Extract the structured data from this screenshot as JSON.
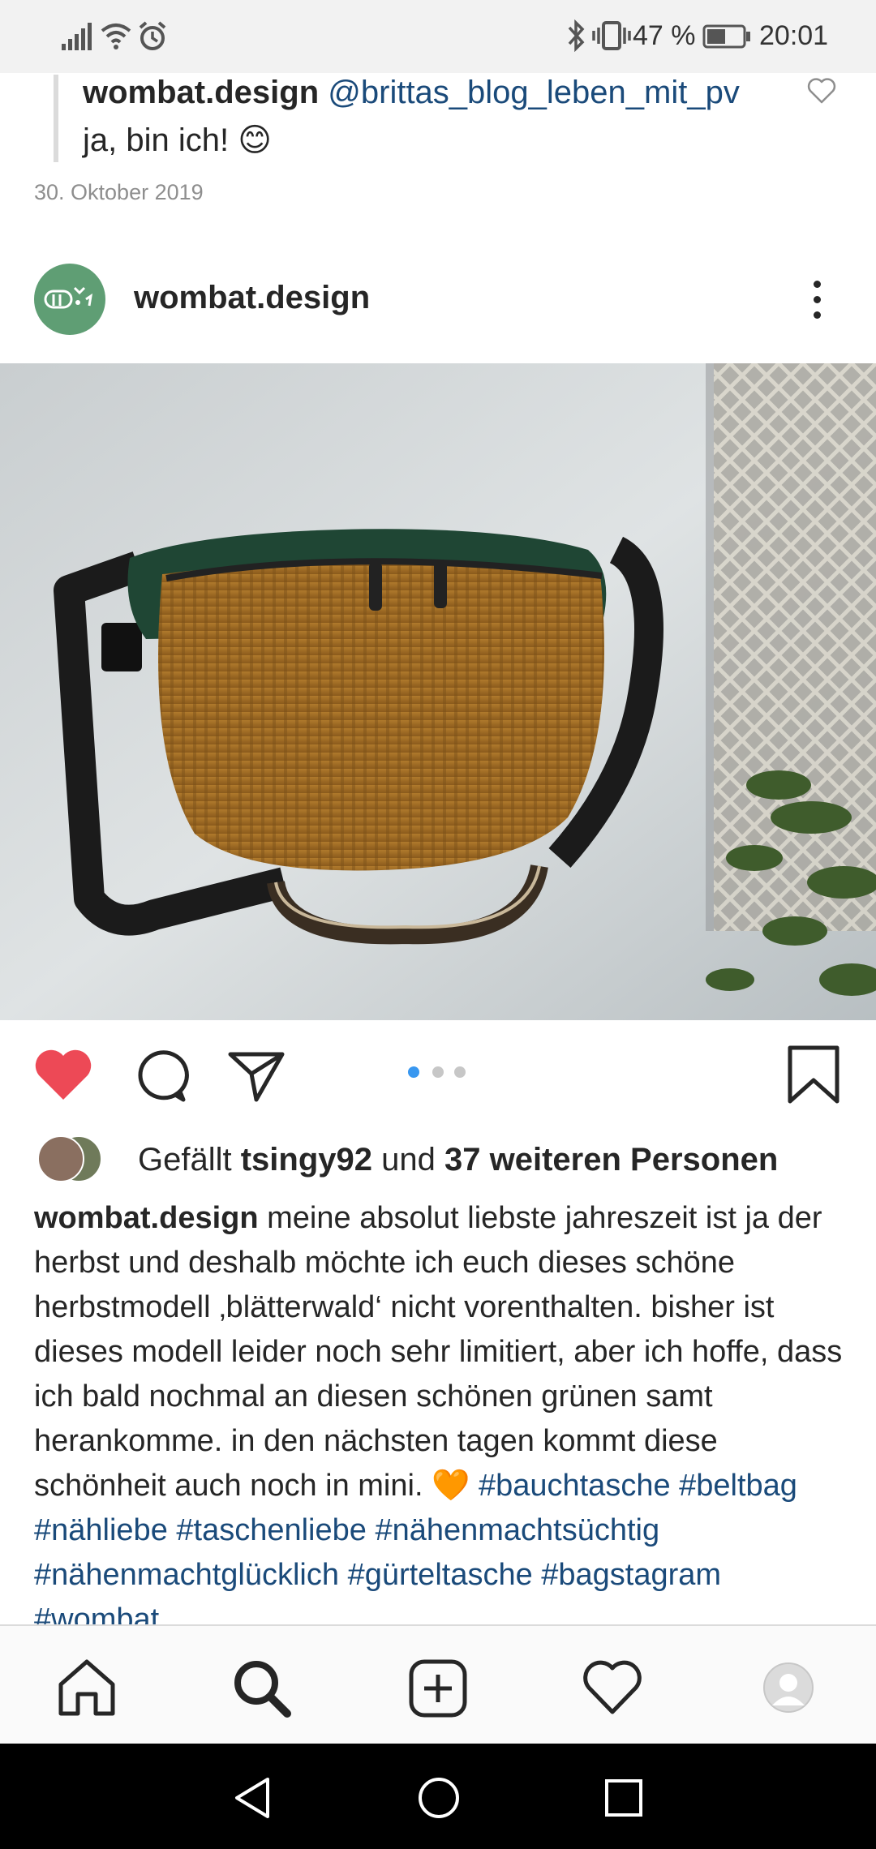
{
  "status_bar": {
    "battery_text": "47 %",
    "time": "20:01",
    "icons": [
      "signal-icon",
      "wifi-icon",
      "alarm-icon",
      "bluetooth-icon",
      "vibrate-icon",
      "battery-icon"
    ]
  },
  "reply": {
    "username": "wombat.design",
    "mention": "@brittas_blog_leben_mit_pv",
    "text": "ja, bin ich! 😊",
    "date": "30. Oktober 2019"
  },
  "post": {
    "username": "wombat.design",
    "photo_alt": "Bauchtasche aus Cord mit grünem Samtdeckel an einer Wand",
    "carousel": {
      "total": 3,
      "active": 0
    },
    "likes": {
      "prefix": "Gefällt",
      "first_user": "tsingy92",
      "joiner": "und",
      "others": "37 weiteren Personen"
    },
    "caption": {
      "username": "wombat.design",
      "text": "meine absolut liebste jahreszeit ist ja der herbst und deshalb möchte ich euch dieses schöne herbstmodell ‚blätterwald‘ nicht vorenthalten. bisher ist dieses modell leider noch sehr limitiert, aber ich hoffe, dass ich bald nochmal an diesen schönen grünen samt herankomme. in den nächsten tagen kommt diese schönheit auch noch in mini. 🧡",
      "hashtags": "#bauchtasche #beltbag #nähliebe #taschenliebe #nähenmachtsüchtig #nähenmachtglücklich #gürteltasche #bagstagram #wombat"
    }
  },
  "colors": {
    "like_red": "#ed4956",
    "link_blue": "#1a4a7a",
    "dot_active": "#3897f0",
    "dot_inactive": "#c7c7c7"
  }
}
